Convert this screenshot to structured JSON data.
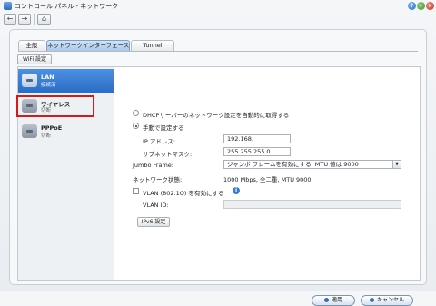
{
  "window": {
    "title": "コントロール パネル - ネットワーク"
  },
  "icons": {
    "app": "network-icon",
    "help": "help-icon",
    "minimize": "minimize-icon",
    "close": "close-icon",
    "back": "back-arrow-icon",
    "forward": "forward-arrow-icon",
    "home": "home-icon",
    "info": "info-icon"
  },
  "toolbar": {
    "back": "←",
    "forward": "→",
    "home": "⌂",
    "help": "?",
    "minimize": "–",
    "close": "×"
  },
  "tabs": [
    {
      "label": "全般",
      "active": false
    },
    {
      "label": "ネットワークインターフェース",
      "active": true
    },
    {
      "label": "Tunnel",
      "active": false
    }
  ],
  "wifi_button": "WiFi 設定",
  "sidebar": {
    "items": [
      {
        "title": "LAN",
        "subtitle": "接続済",
        "active": true
      },
      {
        "title": "ワイヤレス",
        "subtitle": "切断",
        "active": false
      },
      {
        "title": "PPPoE",
        "subtitle": "切断",
        "active": false
      }
    ]
  },
  "form": {
    "dhcp_label": "DHCPサーバーのネットワーク設定を自動的に取得する",
    "manual_label": "手動で設定する",
    "ip_label": "IP アドレス:",
    "ip_value": "192.168.",
    "subnet_label": "サブネットマスク:",
    "subnet_value": "255.255.255.0",
    "jumbo_label": "Jumbo Frame:",
    "jumbo_value": "ジャンボ フレームを有効にする, MTU 値は 9000",
    "status_label": "ネットワーク状態:",
    "status_value": "1000 Mbps, 全二重, MTU 9000",
    "vlan_label": "VLAN (802.1Q) を有効にする",
    "vlan_id_label": "VLAN ID:",
    "vlan_id_value": "",
    "ipv6_button": "IPv6 設定"
  },
  "buttons": {
    "apply": "適用",
    "cancel": "キャンセル"
  },
  "colors": {
    "accent": "#2a6dc6",
    "highlight": "#d41a1a"
  }
}
